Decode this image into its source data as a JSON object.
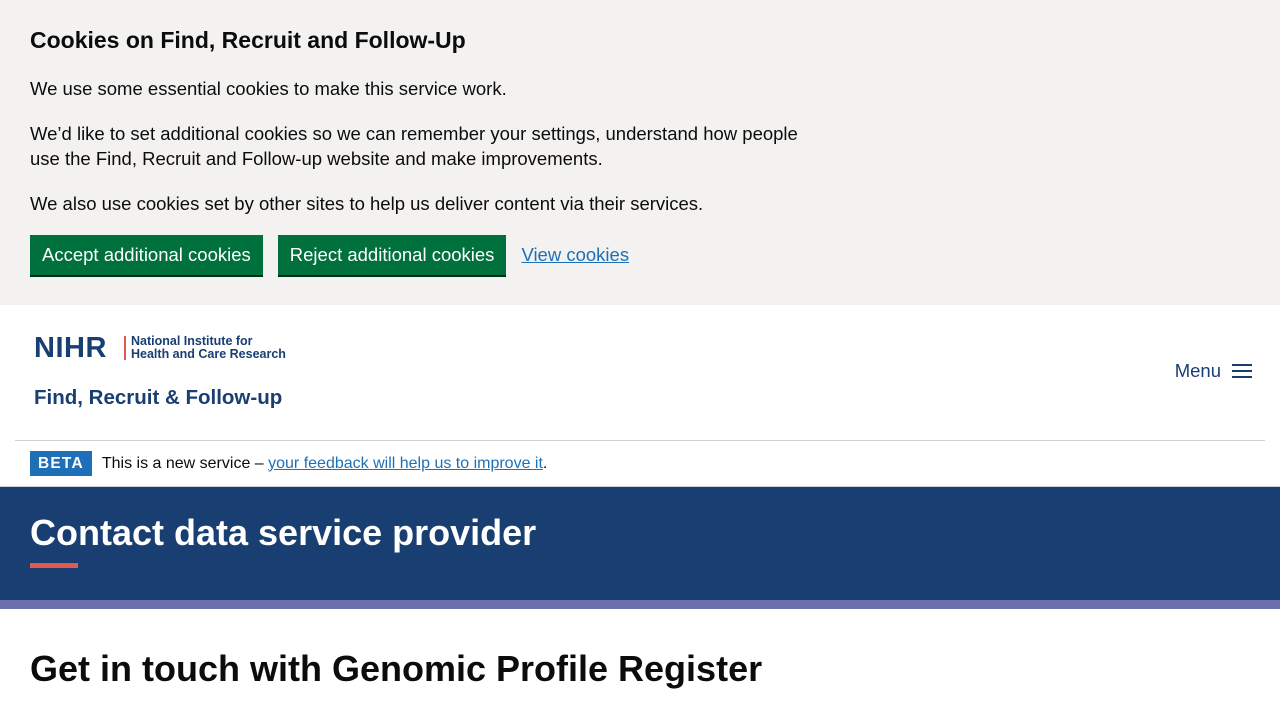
{
  "cookie_banner": {
    "title": "Cookies on Find, Recruit and Follow-Up",
    "paragraph_1": "We use some essential cookies to make this service work.",
    "paragraph_2": "We’d like to set additional cookies so we can remember your settings, understand how people use the Find, Recruit and Follow-up website and make improvements.",
    "paragraph_3": "We also use cookies set by other sites to help us deliver content via their services.",
    "accept_label": "Accept additional cookies",
    "reject_label": "Reject additional cookies",
    "view_label": "View cookies"
  },
  "header": {
    "logo_org_short": "NIHR",
    "logo_org_line1": "National Institute for",
    "logo_org_line2": "Health and Care Research",
    "logo_service": "Find, Recruit & Follow-up",
    "menu_label": "Menu",
    "menu_icon": "hamburger-icon"
  },
  "phase_banner": {
    "tag": "BETA",
    "text_before": "This is a new service – ",
    "link_text": "your feedback will help us to improve it",
    "text_after": "."
  },
  "hero": {
    "title": "Contact data service provider"
  },
  "main": {
    "heading": "Get in touch with Genomic Profile Register"
  },
  "colors": {
    "banner_bg": "#f3f2f1",
    "button_green": "#00703c",
    "link_blue": "#1d70b8",
    "nihr_navy": "#193e72",
    "accent_coral": "#e05a4f",
    "stripe_purple": "#6b6fad"
  }
}
